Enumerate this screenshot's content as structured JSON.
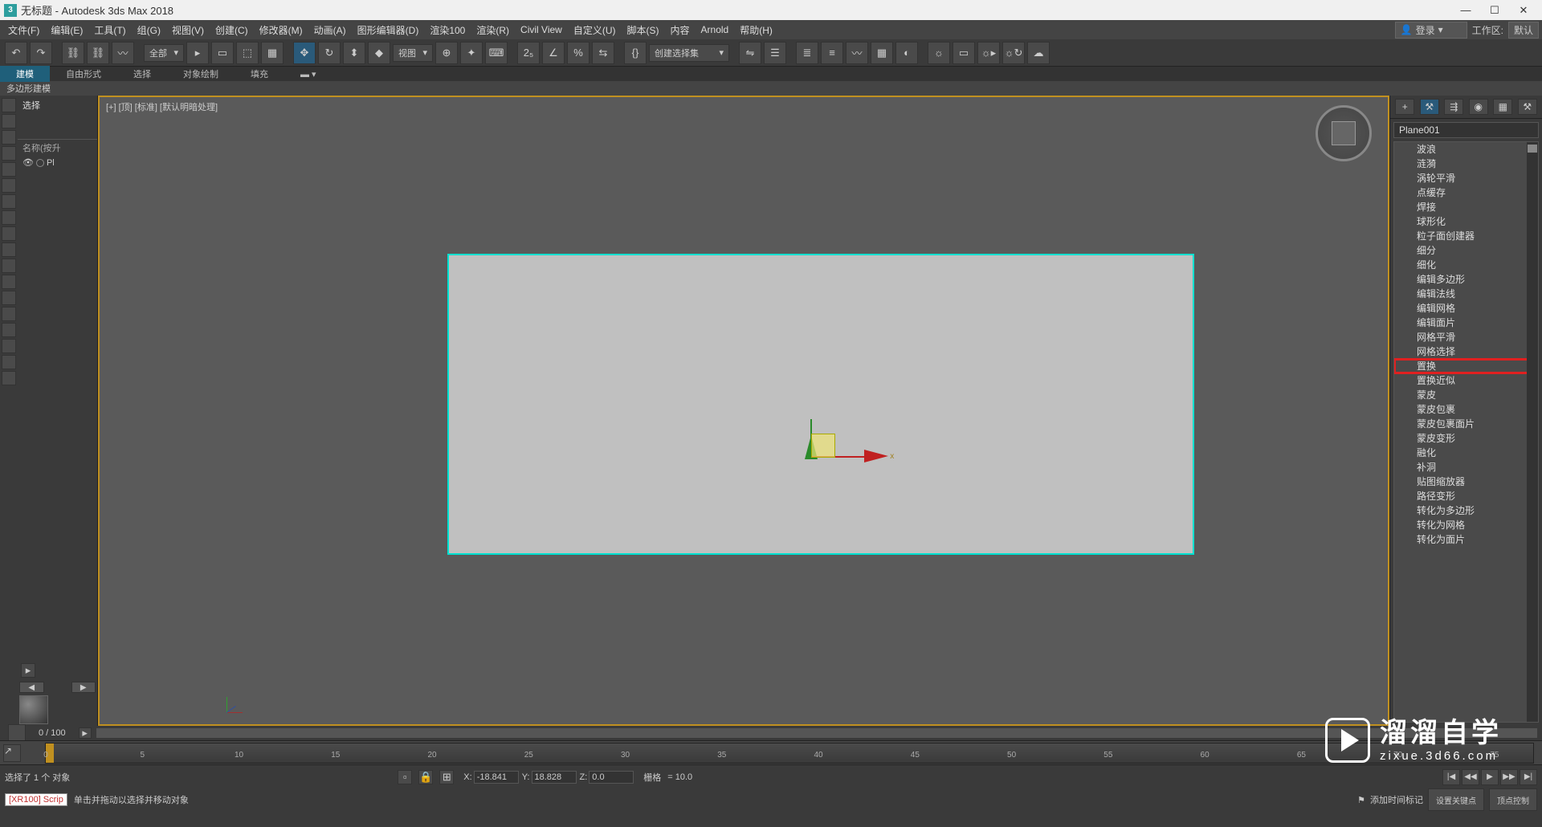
{
  "title": "无标题 - Autodesk 3ds Max 2018",
  "app_icon": "3",
  "win": {
    "min": "—",
    "max": "☐",
    "close": "✕"
  },
  "menu": {
    "items": [
      "文件(F)",
      "编辑(E)",
      "工具(T)",
      "组(G)",
      "视图(V)",
      "创建(C)",
      "修改器(M)",
      "动画(A)",
      "图形编辑器(D)",
      "渲染100",
      "渲染(R)",
      "Civil View",
      "自定义(U)",
      "脚本(S)",
      "内容",
      "Arnold",
      "帮助(H)"
    ],
    "login_label": "登录",
    "workspace_label": "工作区:",
    "workspace_value": "默认"
  },
  "toolbar_top": {
    "all_label": "全部",
    "views_label": "视图",
    "named_sel_label": "创建选择集"
  },
  "ribbon": {
    "tabs": [
      "建模",
      "自由形式",
      "选择",
      "对象绘制",
      "填充"
    ],
    "sub": "多边形建模"
  },
  "scene": {
    "select_label": "选择",
    "sort_label": "名称(按升",
    "row_obj": "Pl"
  },
  "viewport": {
    "label": "[+] [顶] [标准] [默认明暗处理]",
    "x_label": "x"
  },
  "modifier_panel": {
    "object_name": "Plane001",
    "list": [
      "波浪",
      "涟漪",
      "涡轮平滑",
      "点缓存",
      "焊接",
      "球形化",
      "粒子面创建器",
      "细分",
      "细化",
      "编辑多边形",
      "编辑法线",
      "编辑网格",
      "编辑面片",
      "网格平滑",
      "网格选择",
      "置换",
      "置换近似",
      "蒙皮",
      "蒙皮包裹",
      "蒙皮包裹面片",
      "蒙皮变形",
      "融化",
      "补洞",
      "贴图缩放器",
      "路径变形",
      "转化为多边形",
      "转化为网格",
      "转化为面片"
    ],
    "highlight_index": 15
  },
  "slider": {
    "frame_label": "0 / 100"
  },
  "timeline": {
    "ticks": [
      0,
      5,
      10,
      15,
      20,
      25,
      30,
      35,
      40,
      45,
      50,
      55,
      60,
      65,
      70,
      75
    ]
  },
  "status": {
    "selected": "选择了 1 个 对象",
    "hint": "单击并拖动以选择并移动对象",
    "script": "[XR100] Scrip",
    "x": "X:",
    "xv": "-18.841",
    "y": "Y:",
    "yv": "18.828",
    "z": "Z:",
    "zv": "0.0",
    "grid_label": "栅格",
    "grid_value": "= 10.0",
    "add_time_tag": "添加时间标记",
    "set_key": "设置关键点",
    "key_filter": "顶点控制"
  },
  "watermark": {
    "title": "溜溜自学",
    "url": "zixue.3d66.com"
  },
  "icons": {
    "undo": "↶",
    "redo": "↷",
    "link": "⛓",
    "unlink": "⛓",
    "bind": "〰",
    "selreg": "▭",
    "selwin": "⬚",
    "selcross": "▦",
    "move": "✥",
    "rotate": "↻",
    "scale": "⬍",
    "place": "◆",
    "snap": "▭",
    "angle": "∠",
    "percent": "%",
    "spinner": "⇆",
    "mirror": "⇋",
    "align": "☰",
    "layers": "≣",
    "curve": "〰",
    "schm": "▦",
    "matl": "◐",
    "render": "☼",
    "arrow": "▸",
    "play": "▶",
    "stop": "■",
    "next": "▶▶",
    "prev": "◀◀",
    "key": "◆",
    "end": "▶|",
    "start": "|◀",
    "person": "👤",
    "plus": "+",
    "wrench": "⚒",
    "bulb": "◉",
    "grid": "▦",
    "eye": "👁",
    "lock": "🔒",
    "tag": "⚑",
    "cam": "📷",
    "film": "🎬"
  }
}
